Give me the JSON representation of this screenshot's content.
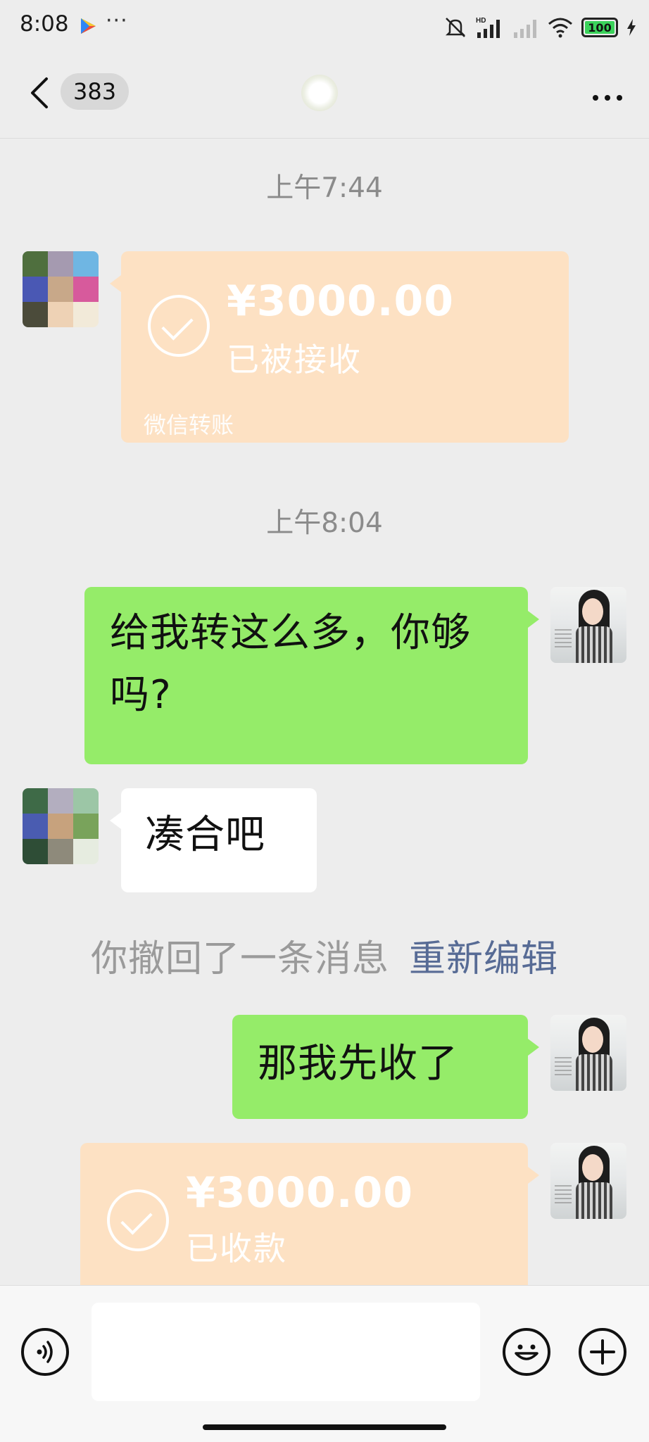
{
  "status_bar": {
    "time": "8:08",
    "dots": "···",
    "battery": "100",
    "network": "HD"
  },
  "header": {
    "unread_count": "383"
  },
  "messages": {
    "ts1": "上午7:44",
    "transfer1": {
      "amount": "¥3000.00",
      "status": "已被接收",
      "footer": "微信转账"
    },
    "ts2": "上午8:04",
    "me1": "给我转这么多，你够吗?",
    "other1": "凑合吧",
    "recall": {
      "text": "你撤回了一条消息",
      "link": "重新编辑"
    },
    "me2": "那我先收了",
    "transfer2": {
      "amount": "¥3000.00",
      "status": "已收款"
    }
  },
  "colors": {
    "background": "#ededed",
    "my_bubble": "#95ec69",
    "other_bubble": "#ffffff",
    "transfer_bubble": "#fde1c3",
    "link": "#576b95"
  }
}
